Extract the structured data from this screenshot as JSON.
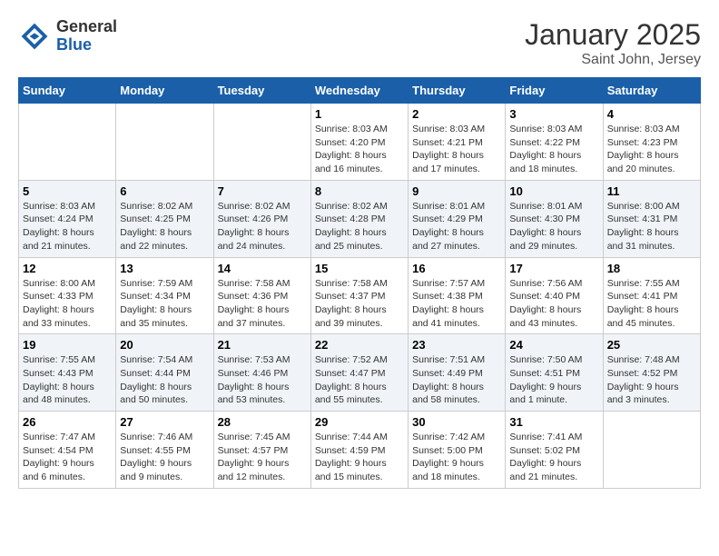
{
  "app": {
    "logo_general": "General",
    "logo_blue": "Blue",
    "title": "January 2025",
    "subtitle": "Saint John, Jersey"
  },
  "calendar": {
    "headers": [
      "Sunday",
      "Monday",
      "Tuesday",
      "Wednesday",
      "Thursday",
      "Friday",
      "Saturday"
    ],
    "weeks": [
      [
        {
          "day": "",
          "info": ""
        },
        {
          "day": "",
          "info": ""
        },
        {
          "day": "",
          "info": ""
        },
        {
          "day": "1",
          "info": "Sunrise: 8:03 AM\nSunset: 4:20 PM\nDaylight: 8 hours\nand 16 minutes."
        },
        {
          "day": "2",
          "info": "Sunrise: 8:03 AM\nSunset: 4:21 PM\nDaylight: 8 hours\nand 17 minutes."
        },
        {
          "day": "3",
          "info": "Sunrise: 8:03 AM\nSunset: 4:22 PM\nDaylight: 8 hours\nand 18 minutes."
        },
        {
          "day": "4",
          "info": "Sunrise: 8:03 AM\nSunset: 4:23 PM\nDaylight: 8 hours\nand 20 minutes."
        }
      ],
      [
        {
          "day": "5",
          "info": "Sunrise: 8:03 AM\nSunset: 4:24 PM\nDaylight: 8 hours\nand 21 minutes."
        },
        {
          "day": "6",
          "info": "Sunrise: 8:02 AM\nSunset: 4:25 PM\nDaylight: 8 hours\nand 22 minutes."
        },
        {
          "day": "7",
          "info": "Sunrise: 8:02 AM\nSunset: 4:26 PM\nDaylight: 8 hours\nand 24 minutes."
        },
        {
          "day": "8",
          "info": "Sunrise: 8:02 AM\nSunset: 4:28 PM\nDaylight: 8 hours\nand 25 minutes."
        },
        {
          "day": "9",
          "info": "Sunrise: 8:01 AM\nSunset: 4:29 PM\nDaylight: 8 hours\nand 27 minutes."
        },
        {
          "day": "10",
          "info": "Sunrise: 8:01 AM\nSunset: 4:30 PM\nDaylight: 8 hours\nand 29 minutes."
        },
        {
          "day": "11",
          "info": "Sunrise: 8:00 AM\nSunset: 4:31 PM\nDaylight: 8 hours\nand 31 minutes."
        }
      ],
      [
        {
          "day": "12",
          "info": "Sunrise: 8:00 AM\nSunset: 4:33 PM\nDaylight: 8 hours\nand 33 minutes."
        },
        {
          "day": "13",
          "info": "Sunrise: 7:59 AM\nSunset: 4:34 PM\nDaylight: 8 hours\nand 35 minutes."
        },
        {
          "day": "14",
          "info": "Sunrise: 7:58 AM\nSunset: 4:36 PM\nDaylight: 8 hours\nand 37 minutes."
        },
        {
          "day": "15",
          "info": "Sunrise: 7:58 AM\nSunset: 4:37 PM\nDaylight: 8 hours\nand 39 minutes."
        },
        {
          "day": "16",
          "info": "Sunrise: 7:57 AM\nSunset: 4:38 PM\nDaylight: 8 hours\nand 41 minutes."
        },
        {
          "day": "17",
          "info": "Sunrise: 7:56 AM\nSunset: 4:40 PM\nDaylight: 8 hours\nand 43 minutes."
        },
        {
          "day": "18",
          "info": "Sunrise: 7:55 AM\nSunset: 4:41 PM\nDaylight: 8 hours\nand 45 minutes."
        }
      ],
      [
        {
          "day": "19",
          "info": "Sunrise: 7:55 AM\nSunset: 4:43 PM\nDaylight: 8 hours\nand 48 minutes."
        },
        {
          "day": "20",
          "info": "Sunrise: 7:54 AM\nSunset: 4:44 PM\nDaylight: 8 hours\nand 50 minutes."
        },
        {
          "day": "21",
          "info": "Sunrise: 7:53 AM\nSunset: 4:46 PM\nDaylight: 8 hours\nand 53 minutes."
        },
        {
          "day": "22",
          "info": "Sunrise: 7:52 AM\nSunset: 4:47 PM\nDaylight: 8 hours\nand 55 minutes."
        },
        {
          "day": "23",
          "info": "Sunrise: 7:51 AM\nSunset: 4:49 PM\nDaylight: 8 hours\nand 58 minutes."
        },
        {
          "day": "24",
          "info": "Sunrise: 7:50 AM\nSunset: 4:51 PM\nDaylight: 9 hours\nand 1 minute."
        },
        {
          "day": "25",
          "info": "Sunrise: 7:48 AM\nSunset: 4:52 PM\nDaylight: 9 hours\nand 3 minutes."
        }
      ],
      [
        {
          "day": "26",
          "info": "Sunrise: 7:47 AM\nSunset: 4:54 PM\nDaylight: 9 hours\nand 6 minutes."
        },
        {
          "day": "27",
          "info": "Sunrise: 7:46 AM\nSunset: 4:55 PM\nDaylight: 9 hours\nand 9 minutes."
        },
        {
          "day": "28",
          "info": "Sunrise: 7:45 AM\nSunset: 4:57 PM\nDaylight: 9 hours\nand 12 minutes."
        },
        {
          "day": "29",
          "info": "Sunrise: 7:44 AM\nSunset: 4:59 PM\nDaylight: 9 hours\nand 15 minutes."
        },
        {
          "day": "30",
          "info": "Sunrise: 7:42 AM\nSunset: 5:00 PM\nDaylight: 9 hours\nand 18 minutes."
        },
        {
          "day": "31",
          "info": "Sunrise: 7:41 AM\nSunset: 5:02 PM\nDaylight: 9 hours\nand 21 minutes."
        },
        {
          "day": "",
          "info": ""
        }
      ]
    ]
  }
}
